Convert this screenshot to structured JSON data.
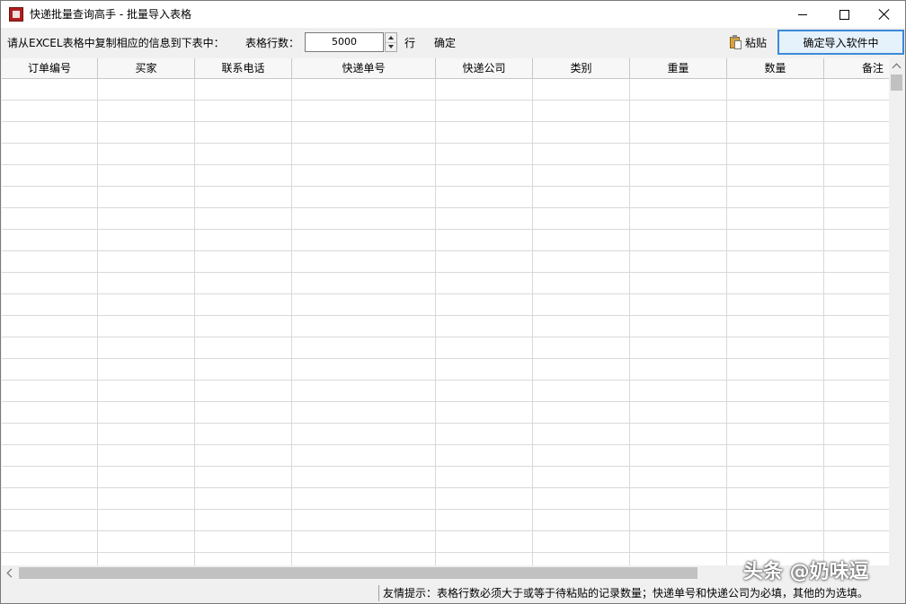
{
  "window": {
    "title": "快递批量查询高手 - 批量导入表格",
    "icon": "app-icon"
  },
  "toolbar": {
    "instruction": "请从EXCEL表格中复制相应的信息到下表中：",
    "rows_label": "表格行数：",
    "rows_value": "5000",
    "row_unit": "行",
    "confirm_label": "确定",
    "paste_label": "粘贴",
    "import_label": "确定导入软件中"
  },
  "grid": {
    "columns": [
      "订单编号",
      "买家",
      "联系电话",
      "快递单号",
      "快递公司",
      "类别",
      "重量",
      "数量",
      "备注"
    ]
  },
  "status": {
    "tip": "友情提示：表格行数必须大于或等于待粘贴的记录数量；快递单号和快递公司为必填，其他的为选填。"
  },
  "watermark": {
    "text": "头条 @奶味逗"
  }
}
